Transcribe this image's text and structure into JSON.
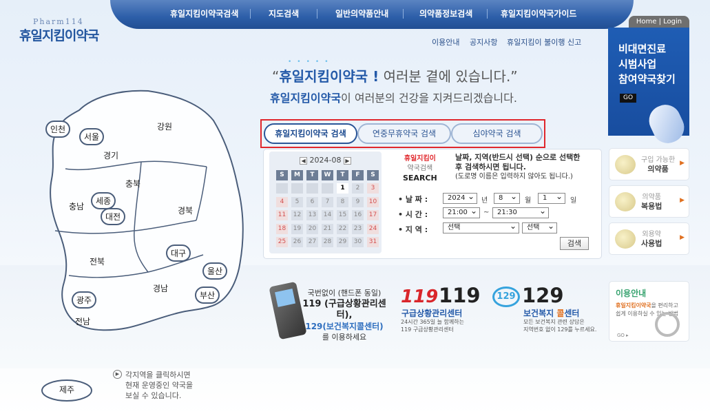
{
  "logo": {
    "top": "Pharm114",
    "main": "휴일지킴이약국"
  },
  "nav": [
    "휴일지킴이약국검색",
    "지도검색",
    "일반의약품안내",
    "의약품정보검색",
    "휴일지킴이약국가이드"
  ],
  "home_login": "Home | Login",
  "sublinks": [
    "이용안내",
    "공지사항",
    "휴일지킴이 불이행 신고"
  ],
  "promo": {
    "line1": "비대면진료",
    "line2": "시범사업",
    "line3": "참여약국찾기",
    "go": "GO"
  },
  "headline": {
    "brand": "휴일지킴이약국 !",
    "text1": " 여러분 곁에 있습니다.",
    "open_quote": "“",
    "close_quote": "”",
    "brand2": "휴일지킴이약국",
    "text2": "이 여러분의 건강을 지켜드리겠습니다."
  },
  "tabs": [
    "휴일지킴이약국 검색",
    "연중무휴약국 검색",
    "심야약국 검색"
  ],
  "calendar": {
    "month": "2024-08",
    "weekdays": [
      "S",
      "M",
      "T",
      "W",
      "T",
      "F",
      "S"
    ],
    "days": [
      "",
      "",
      "",
      "",
      "1",
      "2",
      "3",
      "4",
      "5",
      "6",
      "7",
      "8",
      "9",
      "10",
      "11",
      "12",
      "13",
      "14",
      "15",
      "16",
      "17",
      "18",
      "19",
      "20",
      "21",
      "22",
      "23",
      "24",
      "25",
      "26",
      "27",
      "28",
      "29",
      "30",
      "31"
    ],
    "today": "1"
  },
  "search": {
    "title_red": "휴일지킴이",
    "title_gray": "약국검색",
    "title_bold": "SEARCH",
    "desc1": "날짜, 지역(반드시 선택) 순으로 선택한",
    "desc2": "후 검색하시면 됩니다.",
    "desc3": "(도로명 이름은 입력하지 않아도 됩니다.)",
    "date_label": "• 날 짜 :",
    "time_label": "• 시 간 :",
    "region_label": "• 지 역 :",
    "year": "2024",
    "year_unit": "년",
    "month": "8",
    "month_unit": "월",
    "day": "1",
    "day_unit": "일",
    "time_from": "21:00",
    "time_sep": "~",
    "time_to": "21:30",
    "region1": "선택",
    "region2": "선택",
    "button": "검색"
  },
  "side_cards": [
    {
      "line1": "구입 가능한",
      "line2": "의약품"
    },
    {
      "line1": "의약품",
      "line2": "복용법"
    },
    {
      "line1": "외용약",
      "line2": "사용법"
    }
  ],
  "emergency": {
    "phone_line1": "국번없이 (핸드폰 동일)",
    "phone_line2": "119 (구급상황관리센터),",
    "phone_line3": "129(보건복지콜센터)",
    "phone_line4": "를 이용하세요",
    "logo119": "119",
    "num119": "119",
    "title119": "구급상황관리센터",
    "desc119_1": "24시간 365일 늘 함께하는",
    "desc119_2": "119 구급상황관리센터",
    "logo129": "129",
    "num129": "129",
    "title129_a": "보건복지 ",
    "title129_b": "콜",
    "title129_c": "센터",
    "desc129_1": "모든 보건복지 관련 상담은",
    "desc129_2": "지역번호 없이 129를 누르세요."
  },
  "guide": {
    "title": "이용안내",
    "brand": "휴일지킴이약국",
    "desc": "을 편리하고 쉽게 이용하실 수 있는 방법",
    "go": "GO ▸"
  },
  "map": {
    "regions": [
      "인천",
      "서울",
      "경기",
      "강원",
      "충북",
      "충남",
      "세종",
      "대전",
      "경북",
      "대구",
      "전북",
      "울산",
      "경남",
      "부산",
      "광주",
      "전남",
      "제주"
    ],
    "hint1": "각지역을 클릭하시면",
    "hint2": "현재 운영중인 약국을",
    "hint3": "보실 수 있습니다.",
    "hint_icon": "play-circle-icon"
  }
}
